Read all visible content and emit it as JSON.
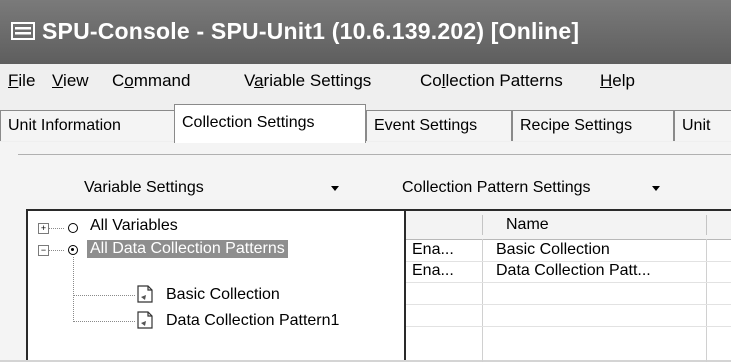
{
  "window": {
    "title": "SPU-Console - SPU-Unit1 (10.6.139.202) [Online]"
  },
  "menu": [
    {
      "pre": "",
      "u": "F",
      "post": "ile"
    },
    {
      "pre": "",
      "u": "V",
      "post": "iew"
    },
    {
      "pre": "C",
      "u": "o",
      "post": "mmand"
    },
    {
      "pre": "V",
      "u": "a",
      "post": "riable Settings"
    },
    {
      "pre": "Co",
      "u": "l",
      "post": "lection Patterns"
    },
    {
      "pre": "",
      "u": "H",
      "post": "elp"
    }
  ],
  "tabs": [
    {
      "label": "Unit Information",
      "active": false
    },
    {
      "label": "Collection Settings",
      "active": true
    },
    {
      "label": "Event Settings",
      "active": false
    },
    {
      "label": "Recipe Settings",
      "active": false
    },
    {
      "label": "Unit",
      "active": false
    }
  ],
  "toolbar": {
    "variable_settings": "Variable Settings",
    "pattern_settings": "Collection Pattern Settings"
  },
  "tree": {
    "all_variables": "All Variables",
    "all_patterns": "All Data Collection Patterns",
    "children": [
      "Basic Collection",
      "Data Collection Pattern1"
    ]
  },
  "list": {
    "columns": [
      "",
      "Name"
    ],
    "rows": [
      {
        "status": "Ena...",
        "name": "Basic Collection"
      },
      {
        "status": "Ena...",
        "name": "Data Collection Patt..."
      }
    ]
  },
  "icons": {
    "window": "console-icon",
    "expand": "plus-box-icon",
    "collapse": "minus-box-icon",
    "document": "document-icon",
    "dropdown": "triangle-down-icon"
  }
}
